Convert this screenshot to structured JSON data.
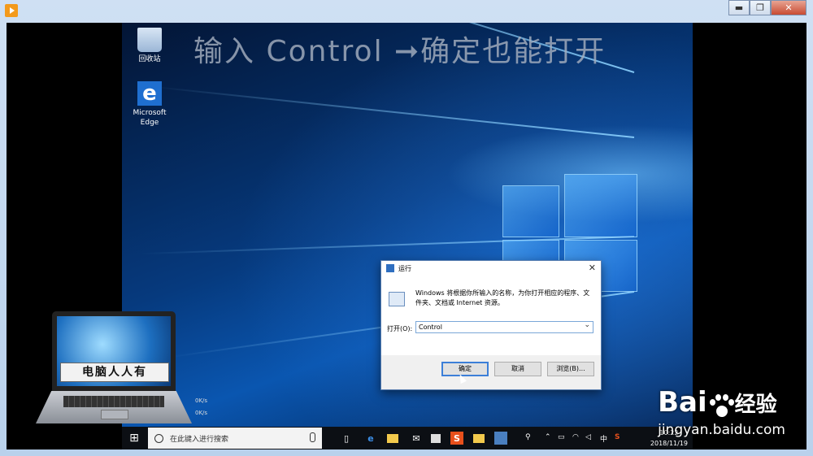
{
  "window": {
    "minimize_symbol": "▬",
    "maximize_symbol": "❐",
    "close_symbol": "✕"
  },
  "overlay_text": "输入 Control ➞确定也能打开",
  "desktop_icons": [
    {
      "label": "回收站",
      "icon": "recycle-bin-icon"
    },
    {
      "label_line1": "Microsoft",
      "label_line2": "Edge",
      "glyph": "e",
      "icon": "edge-icon"
    }
  ],
  "run_dialog": {
    "title": "运行",
    "close_symbol": "✕",
    "description": "Windows 将根据你所输入的名称，为你打开相应的程序、文件夹、文档或 Internet 资源。",
    "open_label": "打开(O):",
    "input_value": "Control",
    "buttons": {
      "ok": "确定",
      "cancel": "取消",
      "browse": "浏览(B)..."
    }
  },
  "laptop_watermark": {
    "text": "电脑人人有"
  },
  "net_speed": {
    "up": "0K/s",
    "down": "0K/s"
  },
  "taskbar": {
    "start_symbol": "⊞",
    "search_placeholder": "在此键入进行搜索",
    "ime": "中",
    "time": "10:22",
    "date": "2018/11/19"
  },
  "baidu_watermark": {
    "brand_left": "Bai",
    "brand_right": "经验",
    "url": "jingyan.baidu.com"
  },
  "colors": {
    "desktop_accent": "#0a56b0",
    "run_ok_border": "#3c7fd8"
  }
}
